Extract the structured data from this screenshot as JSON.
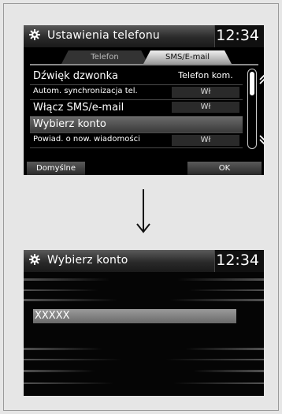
{
  "screen1": {
    "title": "Ustawienia telefonu",
    "clock": "12:34",
    "tabs": [
      {
        "label": "Telefon"
      },
      {
        "label": "SMS/E-mail"
      }
    ],
    "rows": [
      {
        "label": "Dźwięk dzwonka",
        "value": "Telefon kom."
      },
      {
        "label": "Autom. synchronizacja tel.",
        "value": "Wł"
      },
      {
        "label": "Włącz SMS/e-mail",
        "value": "Wł"
      },
      {
        "label": "Wybierz konto",
        "value": ""
      },
      {
        "label": "Powiad. o now. wiadomości",
        "value": "Wł"
      }
    ],
    "buttons": {
      "default_label": "Domyślne",
      "ok_label": "OK"
    }
  },
  "screen2": {
    "title": "Wybierz konto",
    "clock": "12:34",
    "account": "XXXXX"
  },
  "icons": {
    "gear": "gear-icon",
    "scroll_up": "double-chevron-up-icon",
    "scroll_down": "double-chevron-down-icon",
    "transition": "down-arrow-icon"
  }
}
